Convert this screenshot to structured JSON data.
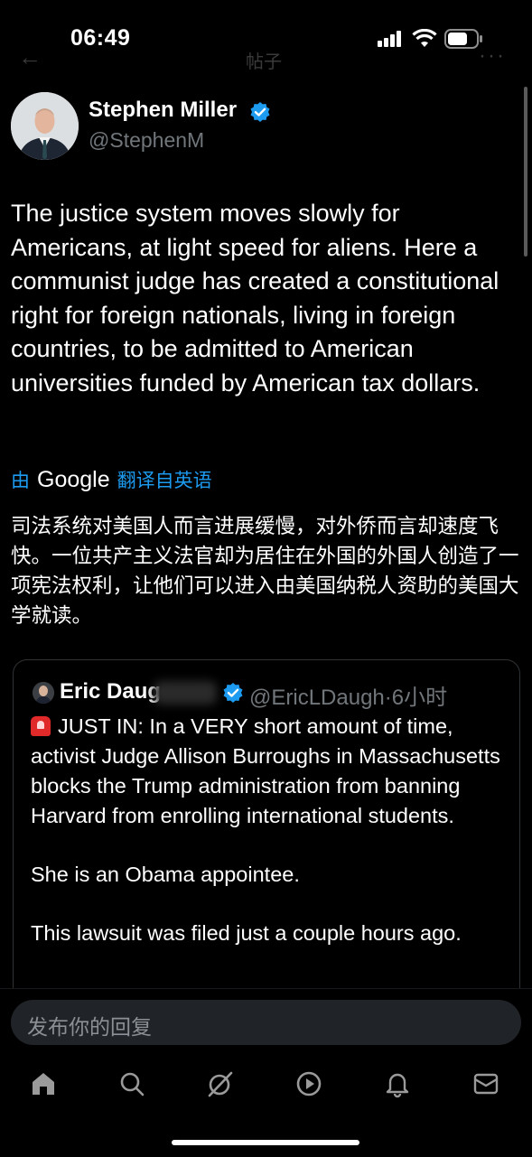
{
  "status_bar": {
    "time": "06:49"
  },
  "nav": {
    "back": "←",
    "title": "帖子",
    "more": "···"
  },
  "author": {
    "name": "Stephen Miller",
    "handle": "@StephenM"
  },
  "tweet": {
    "text": "The justice system moves slowly for Americans, at light speed for aliens. Here a communist judge has created a constitutional right for foreign nationals, living in foreign countries, to be admitted to American universities funded by American tax dollars.",
    "translate_prefix": "由",
    "translate_brand": "Google",
    "translate_suffix": "翻译自英语",
    "translated_text": "司法系统对美国人而言进展缓慢，对外侨而言却速度飞快。一位共产主义法官却为居住在外国的外国人创造了一项宪法权利，让他们可以进入由美国纳税人资助的美国大学就读。"
  },
  "quote": {
    "name": "Eric Daug",
    "handle_time": "@EricLDaugh·6小时",
    "paragraphs": [
      "JUST IN: In a VERY short amount of time, activist Judge Allison Burroughs in Massachusetts blocks the Trump administration from banning Harvard from enrolling international students.",
      "She is an Obama appointee.",
      "This lawsuit was filed just a couple hours ago."
    ]
  },
  "reply": {
    "placeholder": "发布你的回复"
  },
  "tab_bar": {
    "icons": [
      "home-icon",
      "search-icon",
      "grok-icon",
      "video-icon",
      "notifications-icon",
      "messages-icon"
    ]
  },
  "colors": {
    "accent": "#1d9bf0",
    "background": "#000000",
    "secondary_text": "#71767b"
  }
}
